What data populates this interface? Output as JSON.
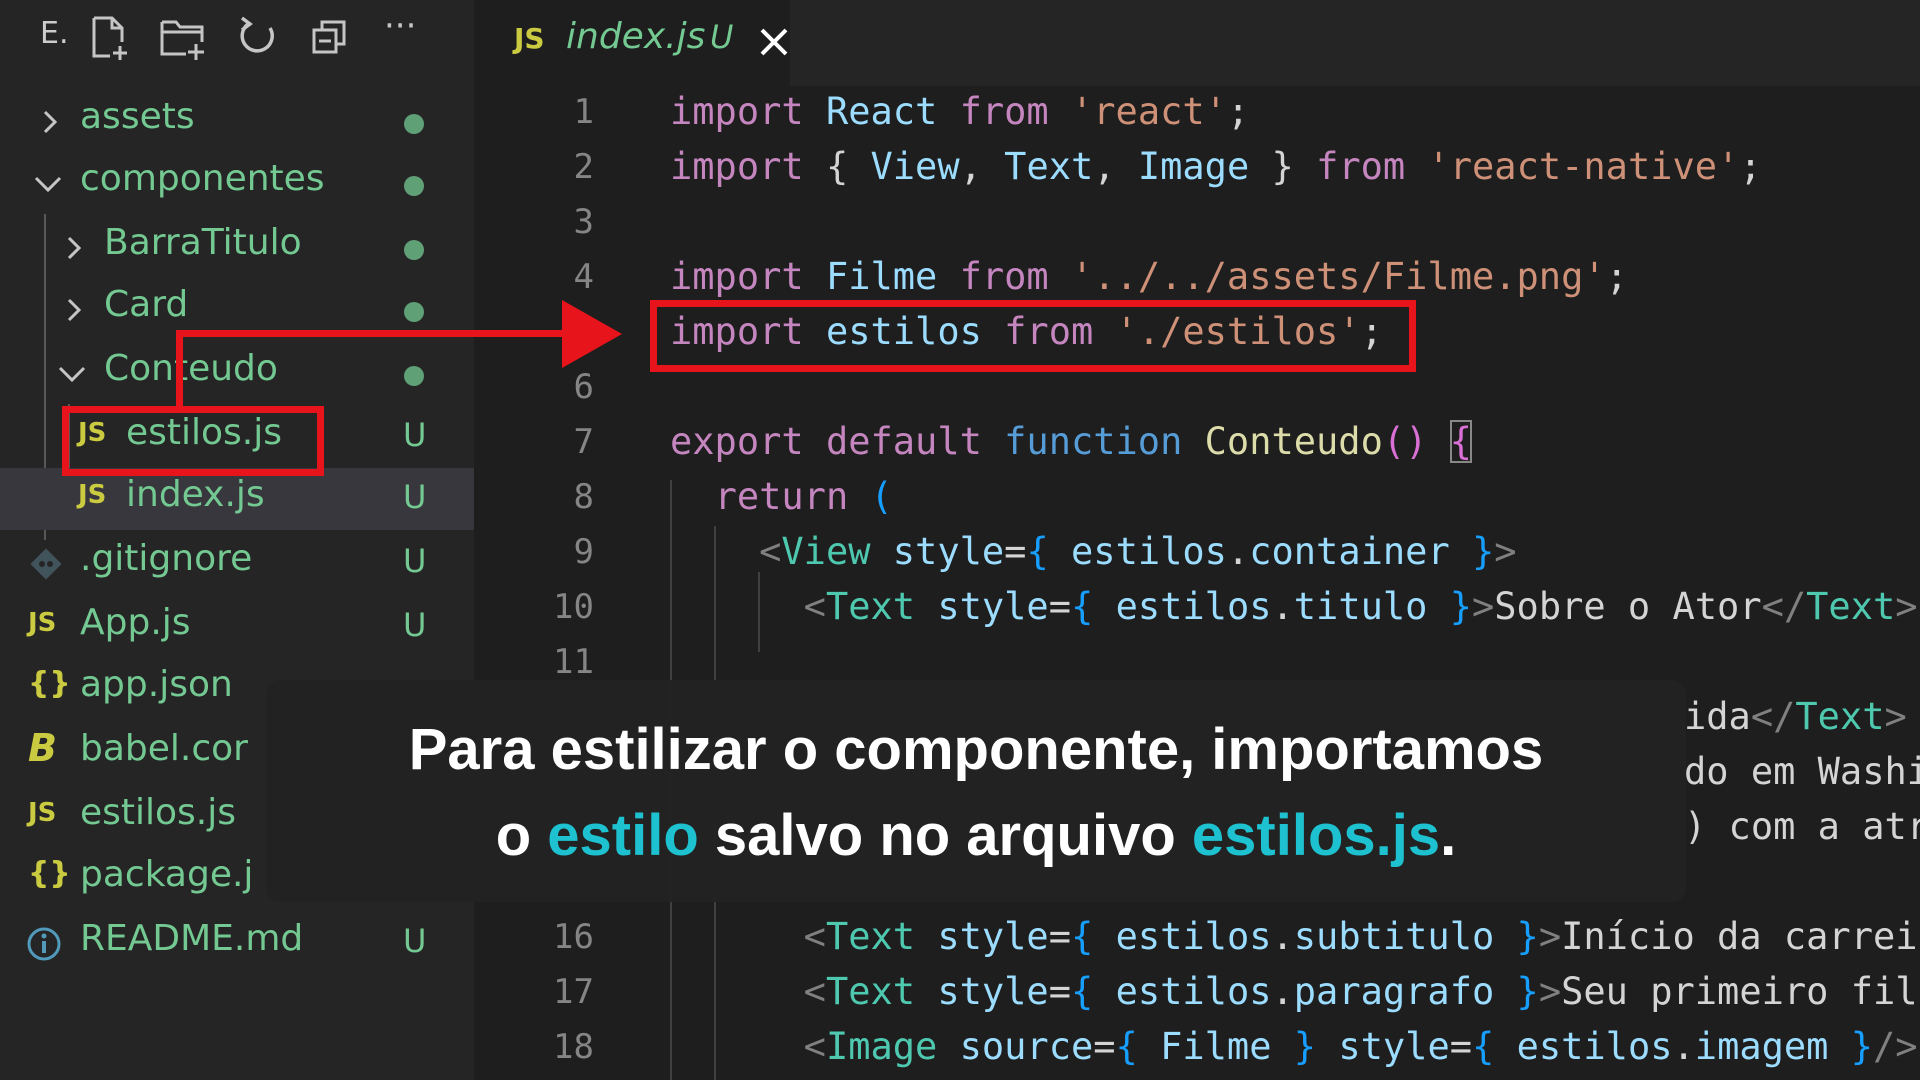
{
  "sidebar": {
    "title": "E.",
    "toolbar_icons": [
      "new-file-icon",
      "new-folder-icon",
      "refresh-icon",
      "collapse-all-icon",
      "more-icon"
    ],
    "toolbar_more": "···",
    "items": [
      {
        "label": "assets",
        "type": "folder",
        "expanded": false,
        "status": "dot"
      },
      {
        "label": "componentes",
        "type": "folder",
        "expanded": true,
        "status": "dot"
      },
      {
        "label": "BarraTitulo",
        "type": "folder",
        "expanded": false,
        "status": "dot"
      },
      {
        "label": "Card",
        "type": "folder",
        "expanded": false,
        "status": "dot"
      },
      {
        "label": "Conteudo",
        "type": "folder",
        "expanded": true,
        "status": "dot"
      },
      {
        "label": "estilos.js",
        "type": "js",
        "status": "U",
        "icon": "JS"
      },
      {
        "label": "index.js",
        "type": "js",
        "status": "U",
        "icon": "JS",
        "active": true
      },
      {
        "label": ".gitignore",
        "type": "git",
        "status": "U"
      },
      {
        "label": "App.js",
        "type": "js",
        "status": "U",
        "icon": "JS"
      },
      {
        "label": "app.json",
        "type": "json",
        "icon": "{}"
      },
      {
        "label": "babel.cor",
        "type": "babel",
        "icon": "B"
      },
      {
        "label": "estilos.js",
        "type": "js",
        "icon": "JS"
      },
      {
        "label": "package.j",
        "type": "json",
        "icon": "{}"
      },
      {
        "label": "README.md",
        "type": "info",
        "status": "U",
        "icon": "i"
      }
    ]
  },
  "tab": {
    "icon": "JS",
    "name": "index.js",
    "badge": "U",
    "close": "✕"
  },
  "editor": {
    "line_numbers": [
      "1",
      "2",
      "3",
      "4",
      "5",
      "6",
      "7",
      "8",
      "9",
      "10",
      "11",
      "16",
      "17",
      "18"
    ],
    "lines": {
      "l1": {
        "kw": "import",
        "id": "React",
        "kw2": "from",
        "str": "'react'",
        "end": ";"
      },
      "l2": {
        "kw": "import",
        "open": "{",
        "a": "View",
        "b": "Text",
        "c": "Image",
        "close": "}",
        "kw2": "from",
        "str": "'react-native'",
        "end": ";"
      },
      "l4": {
        "kw": "import",
        "id": "Filme",
        "kw2": "from",
        "str": "'../../assets/Filme.png'",
        "end": ";"
      },
      "l5": {
        "kw": "import",
        "id": "estilos",
        "kw2": "from",
        "str": "'./estilos'",
        "end": ";"
      },
      "l7": {
        "kw": "export",
        "kw2": "default",
        "kw3": "function",
        "fn": "Conteudo",
        "paren": "()",
        "brace": "{"
      },
      "l8": {
        "kw": "return",
        "paren": "("
      },
      "l9": {
        "tag": "View",
        "attr": "style",
        "expr": "estilos",
        "prop": "container"
      },
      "l10": {
        "tag": "Text",
        "attr": "style",
        "expr": "estilos",
        "prop": "titulo",
        "text": "Sobre o Ator",
        "close_tag": "Text"
      },
      "l13_tail": {
        "text": "ida",
        "close_tag": "Text"
      },
      "l14_tail": {
        "text": "do em Washi"
      },
      "l15_tail": {
        "text": ") com a atr"
      },
      "l16": {
        "tag": "Text",
        "attr": "style",
        "expr": "estilos",
        "prop": "subtitulo",
        "text": "Início da carrei"
      },
      "l17": {
        "tag": "Text",
        "attr": "style",
        "expr": "estilos",
        "prop": "paragrafo",
        "text": "Seu primeiro fil"
      },
      "l18": {
        "tag": "Image",
        "attr": "source",
        "src": "Filme",
        "attr2": "style",
        "expr": "estilos",
        "prop": "imagem"
      }
    }
  },
  "caption": {
    "line1": "Para estilizar o componente, importamos",
    "line2_a": "o ",
    "line2_hl1": "estilo",
    "line2_b": " salvo no arquivo ",
    "line2_hl2": "estilos.js",
    "line2_c": ".",
    "highlight_color": "#1ec1cf"
  },
  "colors": {
    "annotation_red": "#e8141b",
    "git_untracked": "#73c991"
  }
}
